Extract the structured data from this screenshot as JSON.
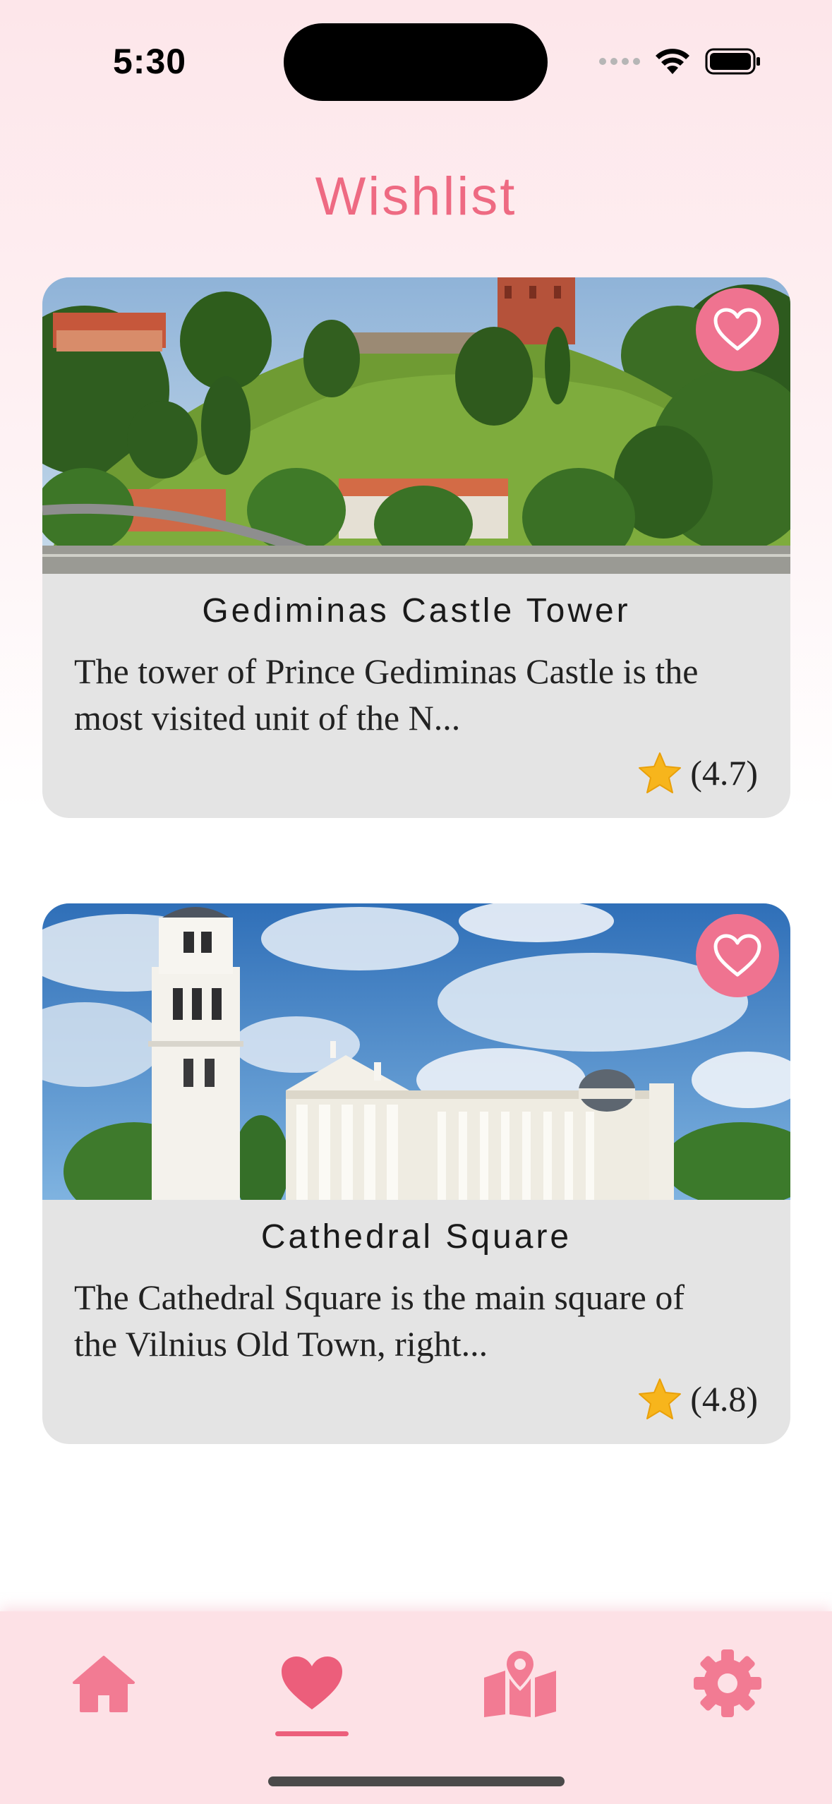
{
  "status_bar": {
    "time": "5:30",
    "icons": [
      "signal-icon",
      "wifi-icon",
      "battery-icon"
    ]
  },
  "header": {
    "title": "Wishlist"
  },
  "wishlist": {
    "items": [
      {
        "title": "Gediminas Castle Tower",
        "description_line1": "The tower of Prince Gediminas Castle is the",
        "description_line2": "most visited unit of the N...",
        "rating": "(4.7)",
        "favorited": true
      },
      {
        "title": "Cathedral Square",
        "description_line1": "The Cathedral Square is the main square of",
        "description_line2": "the Vilnius Old Town, right...",
        "rating": "(4.8)",
        "favorited": true
      }
    ]
  },
  "tab_bar": {
    "tabs": [
      {
        "icon": "home-icon",
        "active": false
      },
      {
        "icon": "heart-icon",
        "active": true
      },
      {
        "icon": "map-icon",
        "active": false
      },
      {
        "icon": "gear-icon",
        "active": false
      }
    ]
  },
  "colors": {
    "accent": "#ec5e7b",
    "tab_icon": "#f27b93",
    "card_bg": "#e4e4e4",
    "tab_bar_bg": "#fde1e6",
    "star": "#f7b51c"
  }
}
